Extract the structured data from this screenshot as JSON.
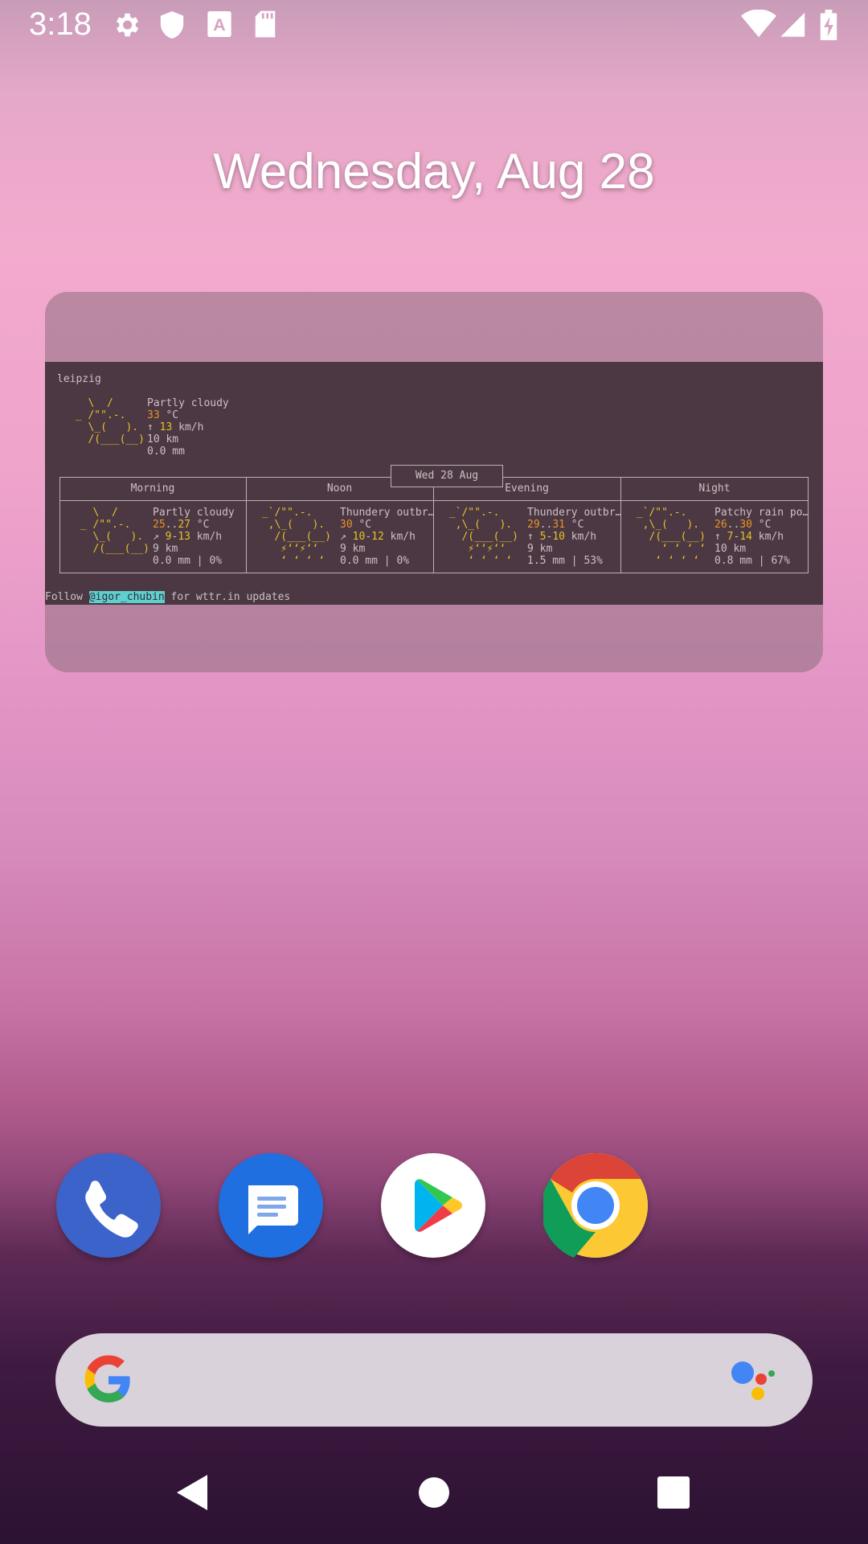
{
  "status_bar": {
    "time": "3:18",
    "left_icons": [
      "settings-icon",
      "shield-icon",
      "font-a-icon",
      "sd-card-icon"
    ],
    "right_icons": [
      "wifi-icon",
      "signal-icon",
      "battery-charging-icon"
    ]
  },
  "home": {
    "date": "Wednesday, Aug 28"
  },
  "weather_widget": {
    "location": "leipzig",
    "current": {
      "condition": "Partly cloudy",
      "temp_value": "33",
      "temp_unit": " °C",
      "wind_arrow": "↑ ",
      "wind_value": "13",
      "wind_unit": " km/h",
      "visibility": "10 km",
      "precip": "0.0 mm"
    },
    "date_tab": "Wed 28 Aug",
    "periods": [
      {
        "name": "Morning",
        "condition": "Partly cloudy",
        "temp_lo": "25",
        "temp_hi": "27",
        "wind_arrow": "↗ ",
        "wind_lo": "9",
        "wind_hi": "13",
        "visibility": "9 km",
        "precip": "0.0 mm | 0%"
      },
      {
        "name": "Noon",
        "condition": "Thundery outbr…",
        "temp_lo": "",
        "temp_hi": "30",
        "wind_arrow": "↗ ",
        "wind_lo": "10",
        "wind_hi": "12",
        "visibility": "9 km",
        "precip": "0.0 mm | 0%"
      },
      {
        "name": "Evening",
        "condition": "Thundery outbr…",
        "temp_lo": "29",
        "temp_hi": "31",
        "wind_arrow": "↑ ",
        "wind_lo": "5",
        "wind_hi": "10",
        "visibility": "9 km",
        "precip": "1.5 mm | 53%"
      },
      {
        "name": "Night",
        "condition": "Patchy rain po…",
        "temp_lo": "26",
        "temp_hi": "30",
        "wind_arrow": "↑ ",
        "wind_lo": "7",
        "wind_hi": "14",
        "visibility": "10 km",
        "precip": "0.8 mm | 67%"
      }
    ],
    "footer_prefix": "Follow ",
    "footer_handle": "@igor_chubin",
    "footer_suffix": " for wttr.in updates"
  },
  "dock": {
    "apps": [
      "phone-app-icon",
      "messages-app-icon",
      "play-store-app-icon",
      "chrome-app-icon"
    ]
  },
  "search_bar": {
    "left_icon": "google-g-icon",
    "right_icon": "assistant-icon"
  },
  "nav_bar": {
    "buttons": [
      "back-button",
      "home-button",
      "recents-button"
    ]
  },
  "colors": {
    "terminal_bg": "#4b3842",
    "yellow": "#e6c02a",
    "orange": "#e6932a",
    "handle_bg": "#5dd0d0"
  }
}
